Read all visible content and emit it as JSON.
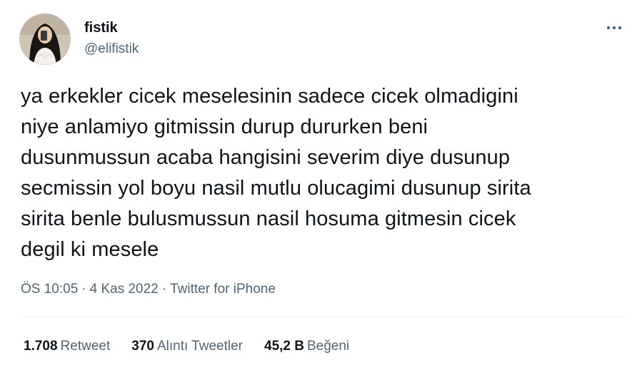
{
  "user": {
    "display_name": "fistik",
    "handle": "@elifistik",
    "avatar_icon": "profile-photo"
  },
  "more_icon": "more-horizontal-icon",
  "tweet": {
    "lines": [
      "ya erkekler cicek meselesinin sadece cicek olmadigini",
      "niye anlamiyo gitmissin durup dururken beni",
      "dusunmussun acaba hangisini severim diye dusunup",
      "secmissin yol boyu nasil mutlu olucagimi dusunup sirita",
      "sirita benle bulusmussun nasil hosuma gitmesin cicek",
      "degil ki mesele"
    ]
  },
  "meta": {
    "time": "ÖS 10:05",
    "separator": "·",
    "date": "4 Kas 2022",
    "source": "Twitter for iPhone"
  },
  "stats": {
    "retweets": {
      "count": "1.708",
      "label": "Retweet"
    },
    "quotes": {
      "count": "370",
      "label": "Alıntı Tweetler"
    },
    "likes": {
      "count": "45,2 B",
      "label": "Beğeni"
    }
  },
  "colors": {
    "text_primary": "#0f1419",
    "text_secondary": "#536471",
    "divider": "#eff3f4",
    "background": "#ffffff"
  }
}
